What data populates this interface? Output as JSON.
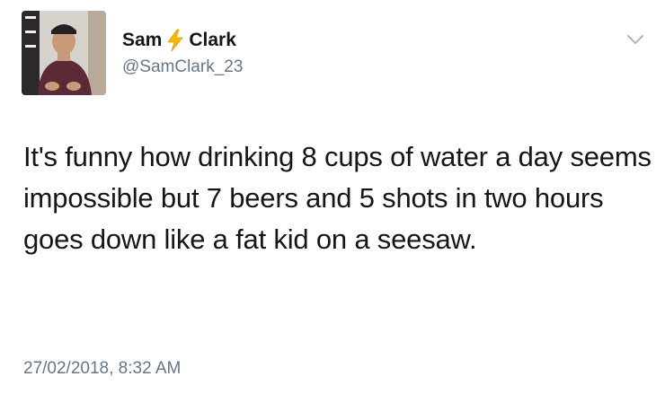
{
  "tweet": {
    "display_name_first": "Sam",
    "display_name_last": "Clark",
    "name_emoji_icon": "lightning-bolt-icon",
    "handle": "@SamClark_23",
    "text": "It's funny how drinking 8 cups of water a day seems impossible but 7 beers and 5 shots in two hours goes down like a fat kid on a seesaw.",
    "timestamp": "27/02/2018, 8:32 AM",
    "menu_icon": "chevron-down-icon"
  },
  "colors": {
    "text_primary": "#14171a",
    "text_secondary": "#657786",
    "bolt": "#f5b800",
    "chevron": "#aab8c2"
  }
}
